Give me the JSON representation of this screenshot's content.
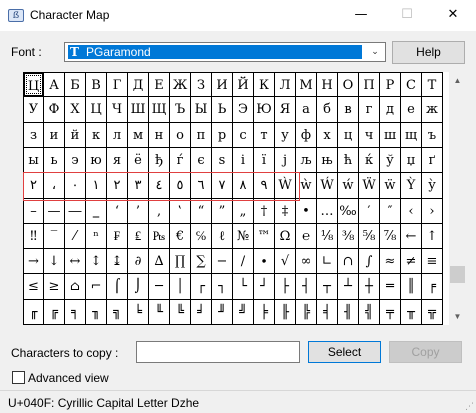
{
  "window": {
    "title": "Character Map",
    "icon": "character-map-icon",
    "icon_glyph": "ẞ",
    "controls": {
      "minimize": "—",
      "maximize": "☐",
      "close": "✕"
    }
  },
  "font": {
    "label": "Font :",
    "selected": "PGaramond",
    "type_glyph": "T",
    "dropdown_icon": "chevron-down-icon",
    "dropdown_glyph": "⌄"
  },
  "help_label": "Help",
  "grid": {
    "columns": 20,
    "rows": [
      [
        "Ц",
        "А",
        "Б",
        "В",
        "Г",
        "Д",
        "Е",
        "Ж",
        "З",
        "И",
        "Й",
        "К",
        "Л",
        "М",
        "Н",
        "О",
        "П",
        "Р",
        "С",
        "Т"
      ],
      [
        "У",
        "Ф",
        "Х",
        "Ц",
        "Ч",
        "Ш",
        "Щ",
        "Ъ",
        "Ы",
        "Ь",
        "Э",
        "Ю",
        "Я",
        "а",
        "б",
        "в",
        "г",
        "д",
        "е",
        "ж"
      ],
      [
        "з",
        "и",
        "й",
        "к",
        "л",
        "м",
        "н",
        "о",
        "п",
        "р",
        "с",
        "т",
        "у",
        "ф",
        "х",
        "ц",
        "ч",
        "ш",
        "щ",
        "ъ"
      ],
      [
        "ы",
        "ь",
        "э",
        "ю",
        "я",
        "ё",
        "ђ",
        "ѓ",
        "є",
        "ѕ",
        "і",
        "ї",
        "ј",
        "љ",
        "њ",
        "ћ",
        "ќ",
        "ў",
        "џ",
        "ґ"
      ],
      [
        "٢",
        "،",
        "٠",
        "١",
        "٢",
        "٣",
        "٤",
        "٥",
        "٦",
        "٧",
        "٨",
        "٩",
        "Ẁ",
        "ẁ",
        "Ẃ",
        "ẃ",
        "Ẅ",
        "ẅ",
        "Ỳ",
        "ỳ"
      ],
      [
        "–",
        "—",
        "―",
        "‗",
        "‘",
        "’",
        "‚",
        "‛",
        "“",
        "”",
        "„",
        "†",
        "‡",
        "•",
        "…",
        "‰",
        "′",
        "″",
        "‹",
        "›"
      ],
      [
        "‼",
        "‾",
        "⁄",
        "ⁿ",
        "₣",
        "₤",
        "₧",
        "€",
        "℅",
        "ℓ",
        "№",
        "™",
        "Ω",
        "℮",
        "⅛",
        "⅜",
        "⅝",
        "⅞",
        "←",
        "↑"
      ],
      [
        "→",
        "↓",
        "↔",
        "↕",
        "↨",
        "∂",
        "∆",
        "∏",
        "∑",
        "−",
        "∕",
        "∙",
        "√",
        "∞",
        "∟",
        "∩",
        "∫",
        "≈",
        "≠",
        "≡"
      ],
      [
        "≤",
        "≥",
        "⌂",
        "⌐",
        "⌠",
        "⌡",
        "─",
        "│",
        "┌",
        "┐",
        "└",
        "┘",
        "├",
        "┤",
        "┬",
        "┴",
        "┼",
        "═",
        "║",
        "╒"
      ],
      [
        "╓",
        "╔",
        "╕",
        "╖",
        "╗",
        "╘",
        "╙",
        "╚",
        "╛",
        "╜",
        "╝",
        "╞",
        "╟",
        "╠",
        "╡",
        "╢",
        "╣",
        "╤",
        "╥",
        "╦"
      ]
    ]
  },
  "scrollbar": {
    "up_glyph": "▲",
    "down_glyph": "▼"
  },
  "copy": {
    "label": "Characters to copy :",
    "value": "",
    "select_label": "Select",
    "copy_label": "Copy"
  },
  "advanced_view": {
    "label": "Advanced view",
    "checked": false
  },
  "status": "U+040F: Cyrillic Capital Letter Dzhe"
}
